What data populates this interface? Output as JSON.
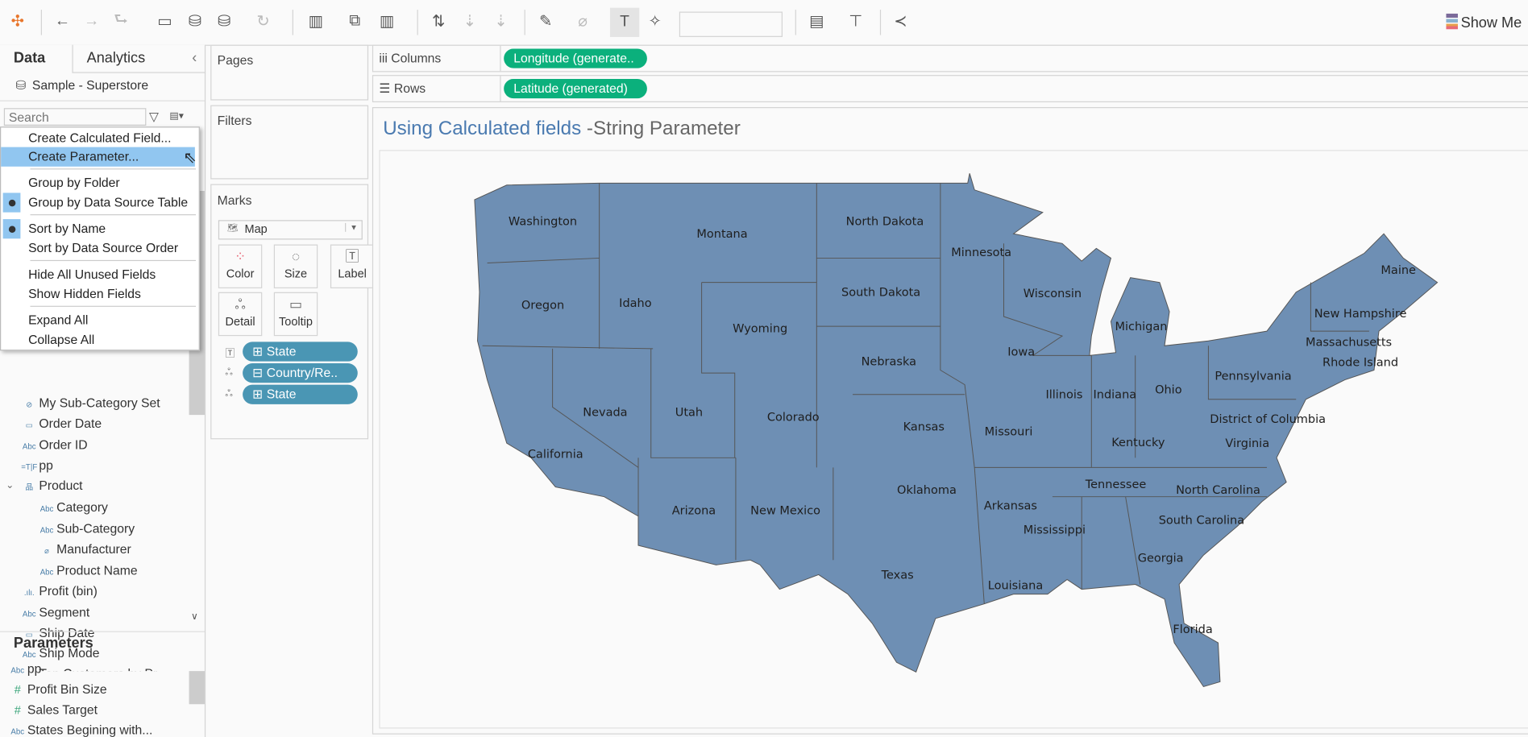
{
  "toolbar": {
    "icons": [
      "tableau-logo-icon",
      "undo-icon",
      "redo-icon",
      "replay-icon",
      "save-icon",
      "new-datasource-icon",
      "pause-updates-icon",
      "refresh-icon",
      "new-worksheet-icon",
      "duplicate-sheet-icon",
      "clear-sheet-icon",
      "swap-icon",
      "sort-asc-icon",
      "sort-desc-icon",
      "highlight-icon",
      "group-icon",
      "show-labels-icon",
      "fix-axes-icon",
      "fit-dropdown",
      "show-cards-icon",
      "presentation-icon",
      "share-icon"
    ],
    "show_me_label": "Show Me",
    "fit_select_value": ""
  },
  "left_pane": {
    "tabs": [
      "Data",
      "Analytics"
    ],
    "datasource": "Sample - Superstore",
    "search_placeholder": "Search",
    "menu": [
      "Create Calculated Field...",
      "Create Parameter...",
      "Group by Folder",
      "Group by Data Source Table",
      "Sort by Name",
      "Sort by Data Source Order",
      "Hide All Unused Fields",
      "Show Hidden Fields",
      "Expand All",
      "Collapse All"
    ],
    "fields": [
      {
        "icon": "set",
        "label": "My Sub-Category Set"
      },
      {
        "icon": "date",
        "label": "Order Date"
      },
      {
        "icon": "Abc",
        "label": "Order ID"
      },
      {
        "icon": "=T|F",
        "label": "pp"
      },
      {
        "icon": "hierarchy",
        "label": "Product"
      },
      {
        "icon": "Abc",
        "label": "Category"
      },
      {
        "icon": "Abc",
        "label": "Sub-Category"
      },
      {
        "icon": "group",
        "label": "Manufacturer"
      },
      {
        "icon": "Abc",
        "label": "Product Name"
      },
      {
        "icon": ".ılı.",
        "label": "Profit (bin)"
      },
      {
        "icon": "Abc",
        "label": "Segment"
      },
      {
        "icon": "date",
        "label": "Ship Date"
      },
      {
        "icon": "Abc",
        "label": "Ship Mode"
      },
      {
        "icon": "set",
        "label": "Top Customers by Pr..."
      }
    ],
    "parameters_title": "Parameters",
    "parameters": [
      {
        "icon": "Abc",
        "label": "pp"
      },
      {
        "icon": "#",
        "label": "Profit Bin Size"
      },
      {
        "icon": "#",
        "label": "Sales Target"
      },
      {
        "icon": "Abc",
        "label": "States Begining with..."
      }
    ]
  },
  "cards": {
    "pages": "Pages",
    "filters": "Filters",
    "marks": "Marks",
    "mark_type": "Map",
    "mark_buttons": [
      "Color",
      "Size",
      "Label",
      "Detail",
      "Tooltip"
    ],
    "mark_pills": [
      "State",
      "Country/Re..",
      "State"
    ]
  },
  "shelves": {
    "columns_label": "Columns",
    "columns_pill": "Longitude (generate..",
    "rows_label": "Rows",
    "rows_pill": "Latitude (generated)"
  },
  "view": {
    "title_bold": "Using Calculated fields",
    "title_rest": " -String Parameter",
    "fill": "#6e8fb4",
    "states": [
      "Washington",
      "Montana",
      "North Dakota",
      "Minnesota",
      "Maine",
      "Oregon",
      "Idaho",
      "South Dakota",
      "Wisconsin",
      "Wyoming",
      "Michigan",
      "New Hampshire",
      "Massachusetts",
      "Rhode Island",
      "Iowa",
      "Nebraska",
      "Pennsylvania",
      "Illinois",
      "Indiana",
      "Ohio",
      "Nevada",
      "Utah",
      "Colorado",
      "Kansas",
      "Missouri",
      "District of Columbia",
      "California",
      "Kentucky",
      "Virginia",
      "Tennessee",
      "North Carolina",
      "Oklahoma",
      "Arkansas",
      "Arizona",
      "New Mexico",
      "South Carolina",
      "Mississippi",
      "Georgia",
      "Texas",
      "Louisiana",
      "Florida"
    ]
  }
}
